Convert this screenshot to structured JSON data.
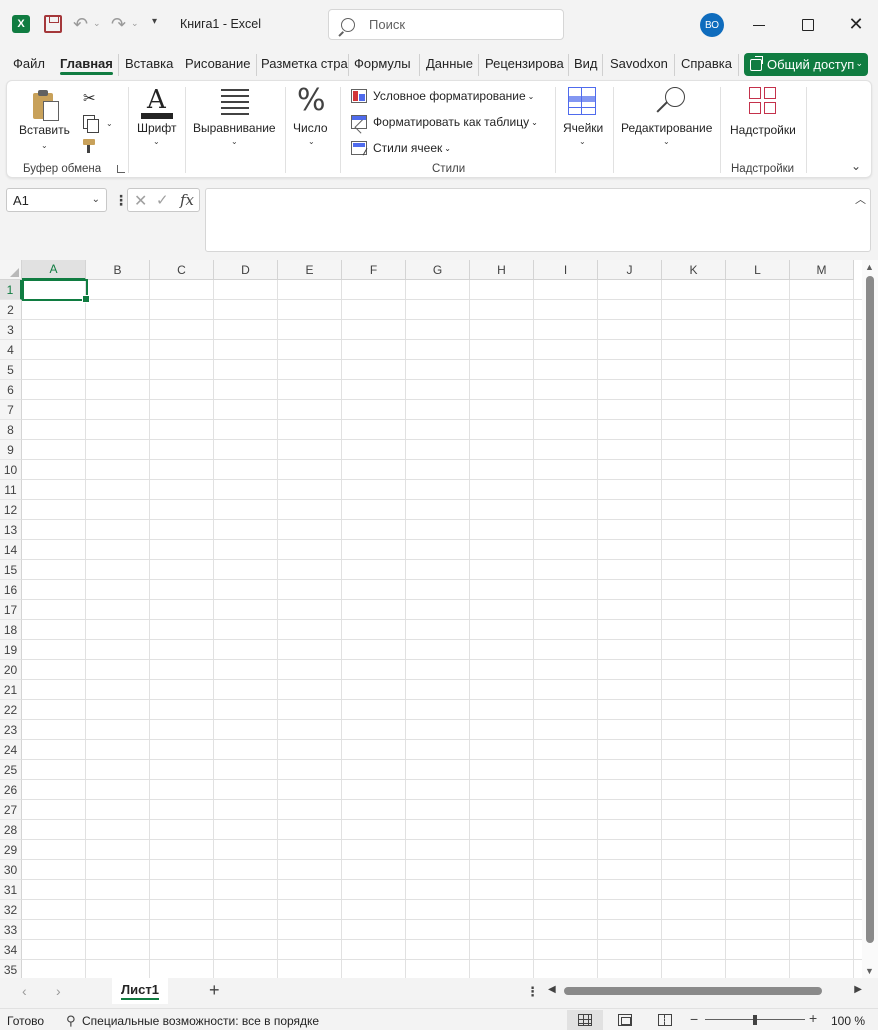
{
  "titlebar": {
    "app_icon": "excel-logo-icon",
    "app_letter": "X",
    "title": "Книга1  -  Excel",
    "search_placeholder": "Поиск",
    "avatar_initials": "ВО"
  },
  "tabs": [
    {
      "label": "Файл",
      "active": false
    },
    {
      "label": "Главная",
      "active": true
    },
    {
      "label": "Вставка",
      "active": false
    },
    {
      "label": "Рисование",
      "active": false
    },
    {
      "label": "Разметка стра",
      "active": false
    },
    {
      "label": "Формулы",
      "active": false
    },
    {
      "label": "Данные",
      "active": false
    },
    {
      "label": "Рецензирова",
      "active": false
    },
    {
      "label": "Вид",
      "active": false
    },
    {
      "label": "Savodxon",
      "active": false
    },
    {
      "label": "Справка",
      "active": false
    }
  ],
  "share_label": "Общий доступ",
  "ribbon": {
    "paste_label": "Вставить",
    "clipboard_group": "Буфер обмена",
    "font_label": "Шрифт",
    "font_icon_letter": "A",
    "alignment_label": "Выравнивание",
    "number_label": "Число",
    "number_icon_glyph": "%",
    "conditional_formatting": "Условное форматирование",
    "format_as_table": "Форматировать как таблицу",
    "cell_styles": "Стили ячеек",
    "styles_group": "Стили",
    "cells_label": "Ячейки",
    "editing_label": "Редактирование",
    "addins_label": "Надстройки",
    "addins_group": "Надстройки"
  },
  "formula_bar": {
    "name_box": "A1",
    "fx": "fx",
    "formula": ""
  },
  "grid": {
    "columns": [
      "A",
      "B",
      "C",
      "D",
      "E",
      "F",
      "G",
      "H",
      "I",
      "J",
      "K",
      "L",
      "M"
    ],
    "rows": [
      "1",
      "2",
      "3",
      "4",
      "5",
      "6",
      "7",
      "8",
      "9",
      "10",
      "11",
      "12",
      "13",
      "14",
      "15",
      "16",
      "17",
      "18",
      "19",
      "20",
      "21",
      "22",
      "23",
      "24",
      "25",
      "26",
      "27",
      "28",
      "29",
      "30",
      "31",
      "32",
      "33",
      "34",
      "35"
    ],
    "active_cell": "A1",
    "accent_color": "#107c41"
  },
  "sheets": [
    {
      "label": "Лист1",
      "active": true
    }
  ],
  "status": {
    "ready": "Готово",
    "accessibility": "Специальные возможности: все в порядке",
    "zoom": "100 %"
  }
}
